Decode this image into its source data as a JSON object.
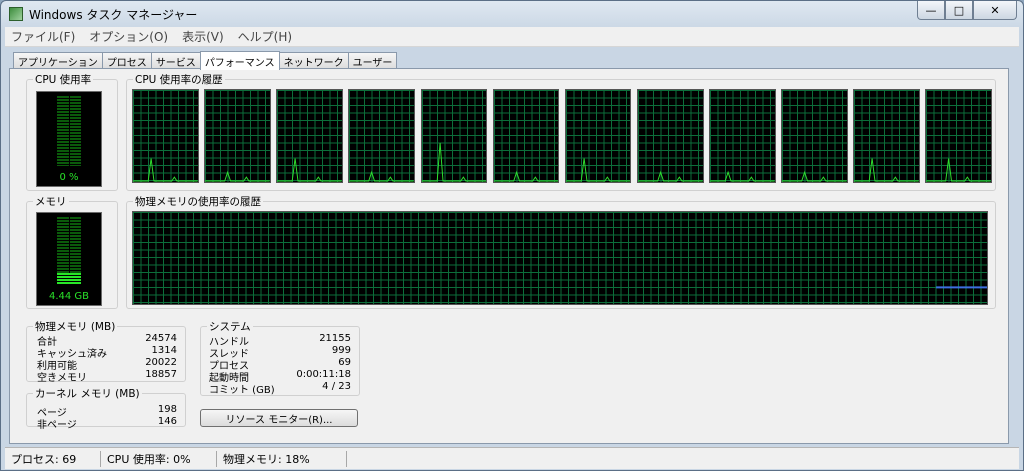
{
  "window": {
    "title": "Windows タスク マネージャー"
  },
  "controls": {
    "minimize": "—",
    "maximize": "□",
    "close": "✕"
  },
  "menu": [
    "ファイル(F)",
    "オプション(O)",
    "表示(V)",
    "ヘルプ(H)"
  ],
  "tabs": [
    "アプリケーション",
    "プロセス",
    "サービス",
    "パフォーマンス",
    "ネットワーク",
    "ユーザー"
  ],
  "active_tab": "パフォーマンス",
  "cpu": {
    "label": "CPU 使用率",
    "value_text": "0 %",
    "fraction": 0.0,
    "history_label": "CPU 使用率の履歴",
    "cores": 12
  },
  "memory": {
    "label": "メモリ",
    "value_text": "4.44 GB",
    "fraction": 0.18,
    "history_label": "物理メモリの使用率の履歴"
  },
  "physical_memory": {
    "label": "物理メモリ (MB)",
    "rows": [
      {
        "name": "合計",
        "value": "24574"
      },
      {
        "name": "キャッシュ済み",
        "value": "1314"
      },
      {
        "name": "利用可能",
        "value": "20022"
      },
      {
        "name": "空きメモリ",
        "value": "18857"
      }
    ]
  },
  "kernel_memory": {
    "label": "カーネル メモリ (MB)",
    "rows": [
      {
        "name": "ページ",
        "value": "198"
      },
      {
        "name": "非ページ",
        "value": "146"
      }
    ]
  },
  "system": {
    "label": "システム",
    "rows": [
      {
        "name": "ハンドル",
        "value": "21155"
      },
      {
        "name": "スレッド",
        "value": "999"
      },
      {
        "name": "プロセス",
        "value": "69"
      },
      {
        "name": "起動時間",
        "value": "0:00:11:18"
      },
      {
        "name": "コミット (GB)",
        "value": "4 / 23"
      }
    ]
  },
  "resource_monitor_button": "リソース モニター(R)...",
  "status": {
    "processes": "プロセス: 69",
    "cpu": "CPU 使用率: 0%",
    "memory": "物理メモリ: 18%"
  }
}
